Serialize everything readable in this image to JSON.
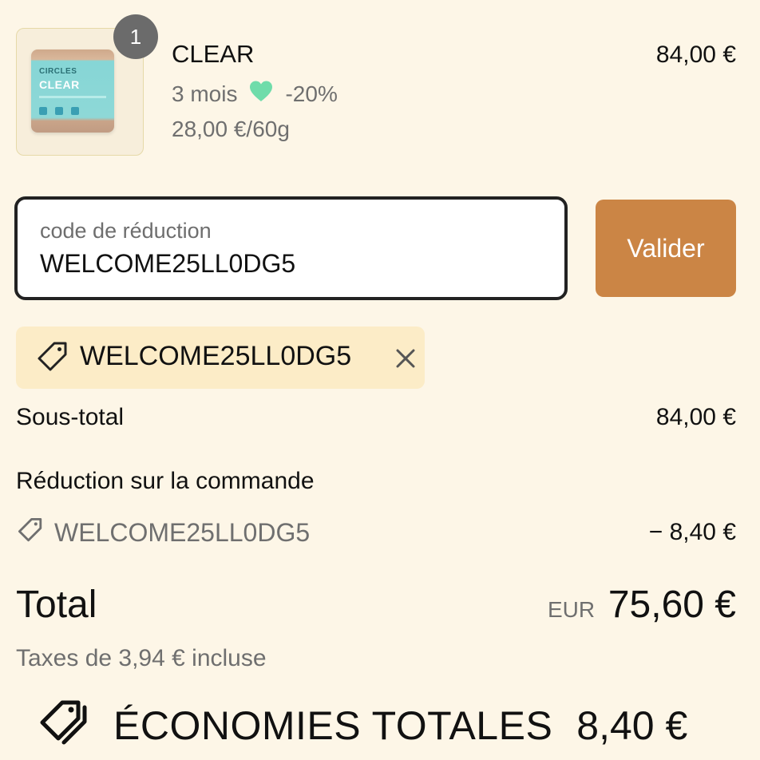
{
  "product": {
    "quantity": "1",
    "image_brand": "CIRCLES",
    "image_name": "CLEAR",
    "name": "CLEAR",
    "variant_duration": "3 mois",
    "variant_discount": "-20%",
    "unit_price": "28,00 €/60g",
    "price": "84,00 €",
    "heart_color": "#6fdcaa"
  },
  "discount_field": {
    "label": "code de réduction",
    "value": "WELCOME25LL0DG5"
  },
  "validate_button": {
    "label": "Valider",
    "color": "#cb8545"
  },
  "applied_code": {
    "code": "WELCOME25LL0DG5",
    "chip_color": "#fcecc7"
  },
  "summary": {
    "subtotal_label": "Sous-total",
    "subtotal_value": "84,00 €",
    "order_discount_label": "Réduction sur la commande",
    "order_discount_code": "WELCOME25LL0DG5",
    "order_discount_value": "− 8,40 €",
    "total_label": "Total",
    "currency": "EUR",
    "total_value": "75,60 €",
    "taxes": "Taxes de 3,94 € incluse"
  },
  "savings": {
    "label": "ÉCONOMIES TOTALES",
    "value": "8,40 €"
  }
}
